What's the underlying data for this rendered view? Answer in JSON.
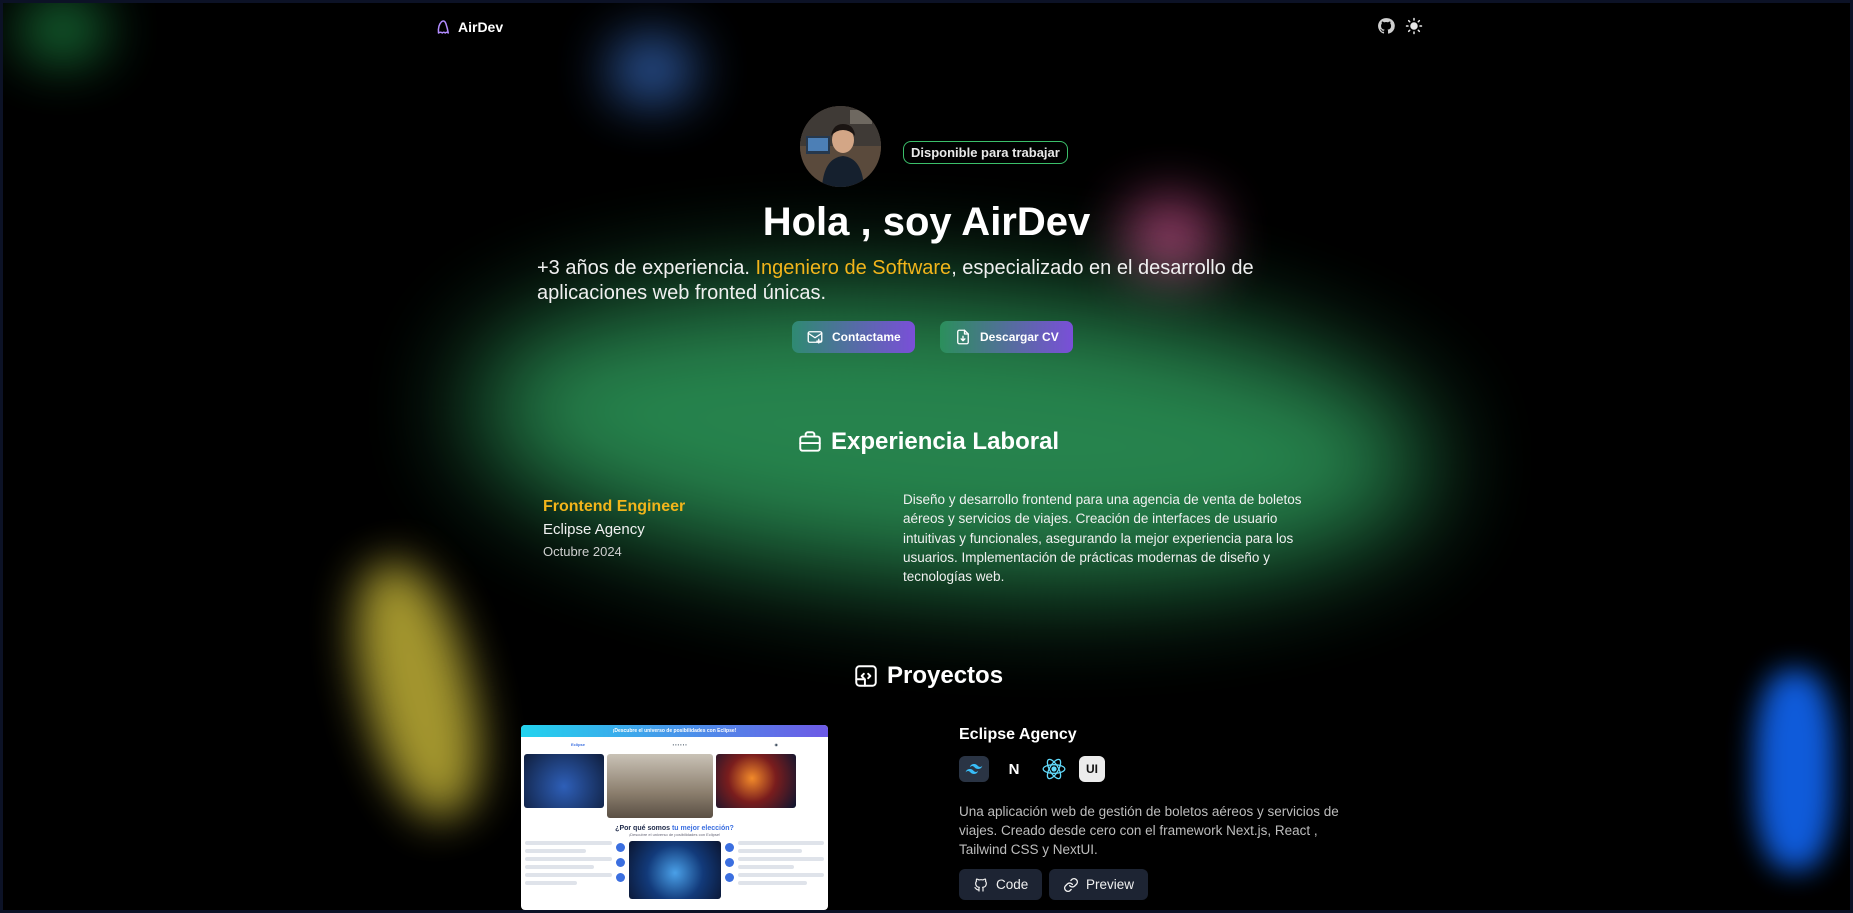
{
  "nav": {
    "brand": "AirDev",
    "icons": [
      "ghost-logo-icon",
      "github-icon",
      "sun-icon"
    ]
  },
  "hero": {
    "badge": "Disponible para trabajar",
    "title": "Hola , soy AirDev",
    "subtitle_pre": "+3 años de experiencia. ",
    "subtitle_highlight": "Ingeniero de Software",
    "subtitle_post": ", especializado en el desarrollo de aplicaciones web fronted únicas.",
    "contact_label": "Contactame",
    "cv_label": "Descargar CV"
  },
  "experience": {
    "section_title": "Experiencia Laboral",
    "items": [
      {
        "role": "Frontend Engineer",
        "company": "Eclipse Agency",
        "date": "Octubre 2024",
        "description": "Diseño y desarrollo frontend para una agencia de venta de boletos aéreos y servicios de viajes. Creación de interfaces de usuario intuitivas y funcionales, asegurando la mejor experiencia para los usuarios. Implementación de prácticas modernas de diseño y tecnologías web."
      }
    ]
  },
  "projects": {
    "section_title": "Proyectos",
    "items": [
      {
        "name": "Eclipse Agency",
        "tags": [
          "tailwind-icon",
          "nextjs-icon",
          "react-icon",
          "nextui-icon"
        ],
        "tag_ui_text": "UI",
        "tag_next_text": "N",
        "description": "Una aplicación web de gestión de boletos aéreos y servicios de viajes. Creado desde cero con el framework Next.js, React , Tailwind CSS y NextUI.",
        "code_label": "Code",
        "preview_label": "Preview",
        "preview": {
          "banner": "¡Descubre el universo de posibilidades con Eclipse!",
          "brand": "Eclipse",
          "heading_pre": "¿Por qué somos ",
          "heading_highlight": "tu mejor elección?",
          "subheading": "¡Descubre el universo de posibilidades con Eclipse!"
        }
      }
    ]
  },
  "colors": {
    "accent": "#f2b51b",
    "badge_border": "#3bbf6a",
    "button_gradient_start": "#2f8a72",
    "button_gradient_end": "#7a4fd8",
    "project_button_bg": "#1d2433"
  }
}
